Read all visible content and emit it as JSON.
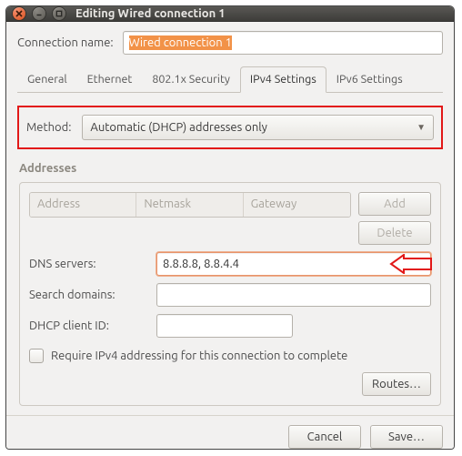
{
  "window": {
    "title": "Editing Wired connection 1"
  },
  "form": {
    "connection_name_label": "Connection name:",
    "connection_name_value": "Wired connection 1"
  },
  "tabs": [
    "General",
    "Ethernet",
    "802.1x Security",
    "IPv4 Settings",
    "IPv6 Settings"
  ],
  "active_tab": "IPv4 Settings",
  "method": {
    "label": "Method:",
    "value": "Automatic (DHCP) addresses only"
  },
  "addresses": {
    "title": "Addresses",
    "headers": [
      "Address",
      "Netmask",
      "Gateway"
    ],
    "add": "Add",
    "delete": "Delete"
  },
  "fields": {
    "dns_label": "DNS servers:",
    "dns_value": "8.8.8.8, 8.8.4.4",
    "search_label": "Search domains:",
    "search_value": "",
    "dhcp_label": "DHCP client ID:",
    "dhcp_value": ""
  },
  "require_label": "Require IPv4 addressing for this connection to complete",
  "routes": "Routes…",
  "footer": {
    "cancel": "Cancel",
    "save": "Save…"
  }
}
